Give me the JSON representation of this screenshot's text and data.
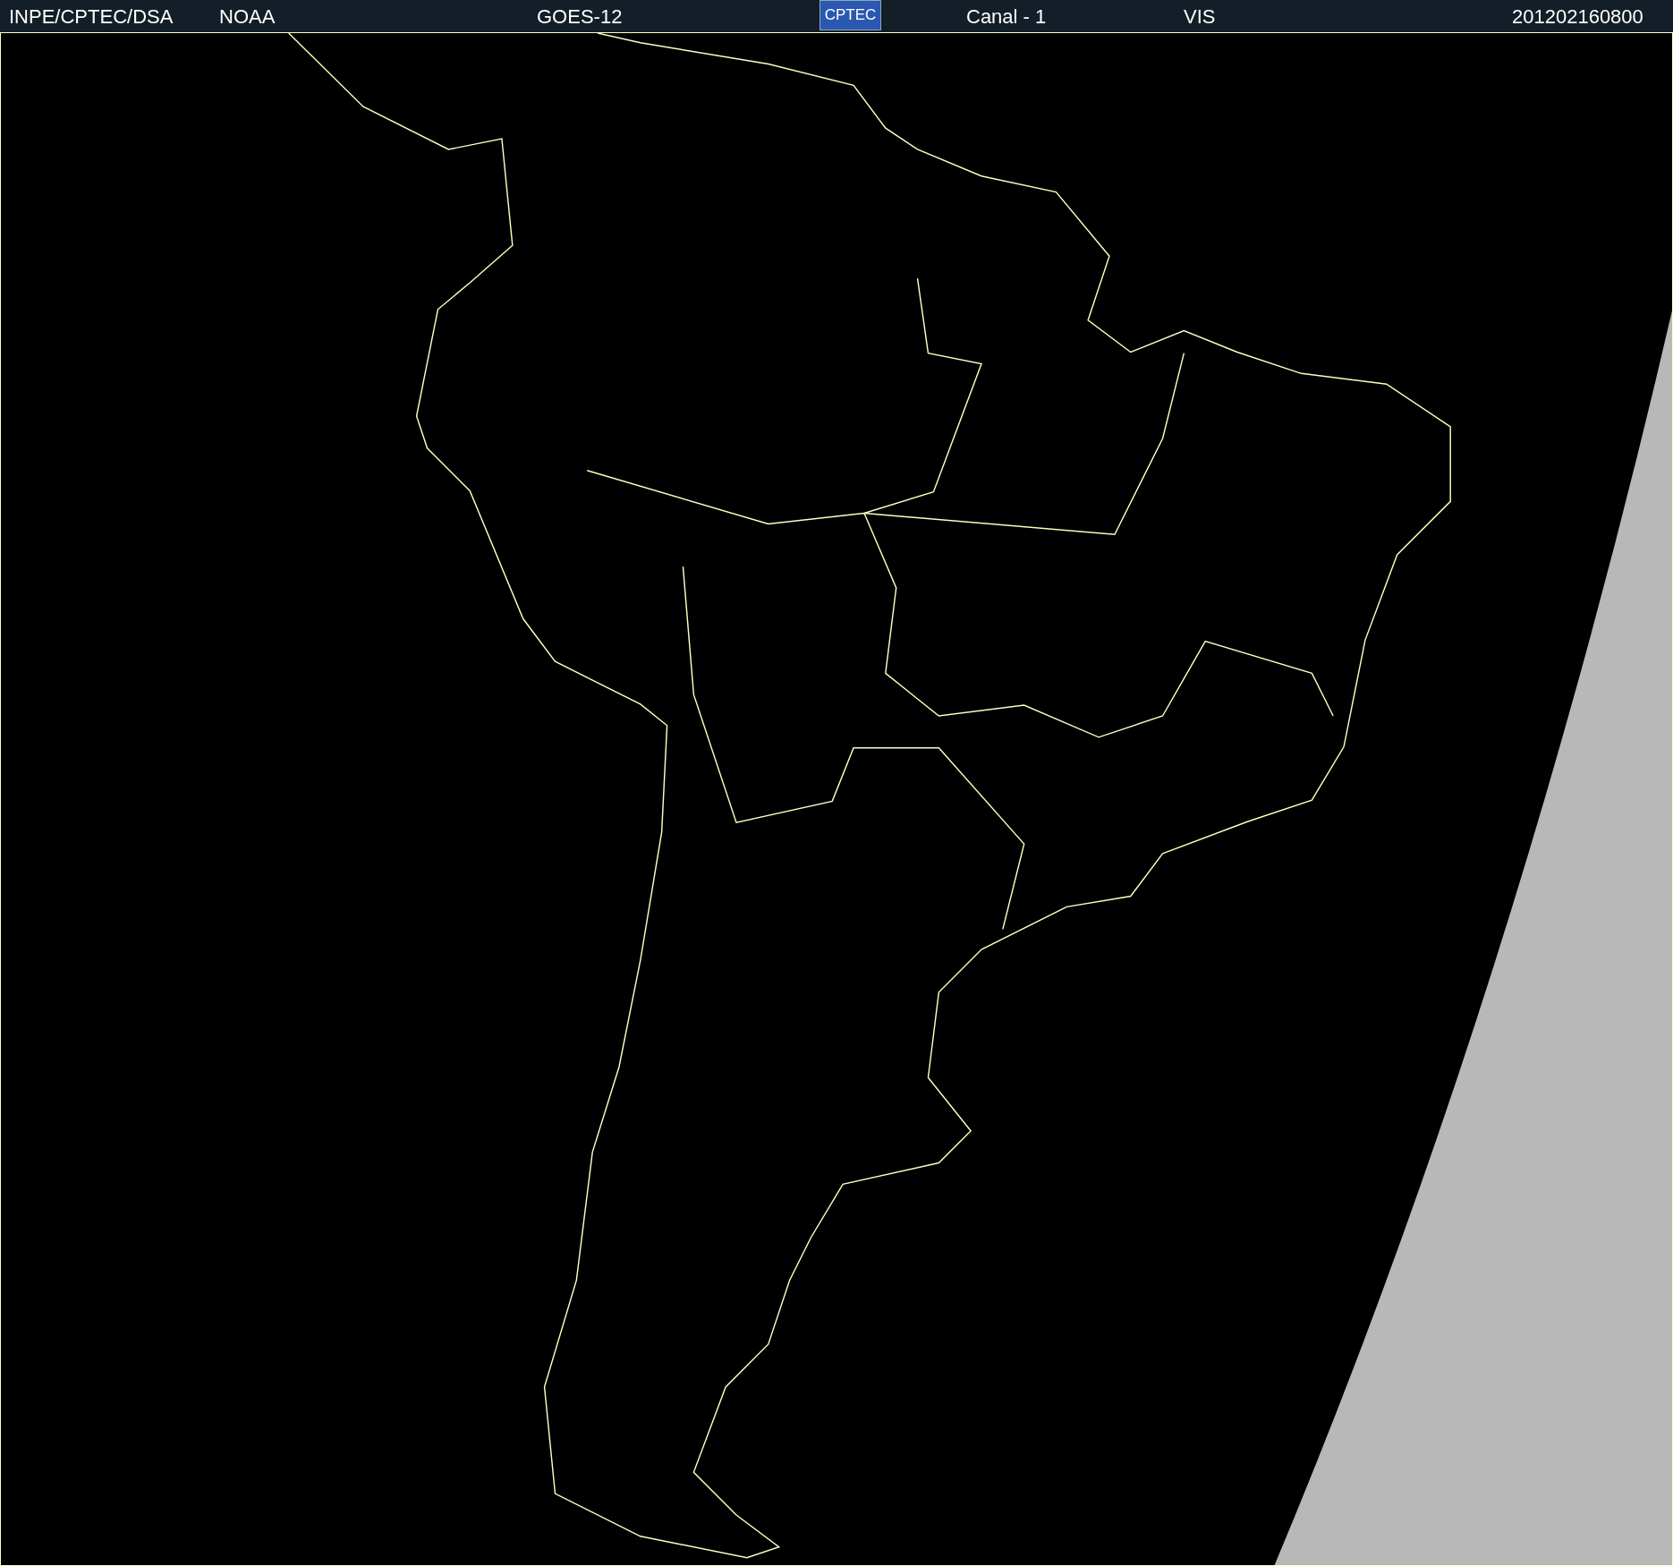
{
  "header": {
    "items": [
      {
        "kind": "text",
        "text": "INPE/CPTEC/DSA"
      },
      {
        "kind": "text",
        "text": "NOAA"
      },
      {
        "kind": "text",
        "text": "GOES-12"
      },
      {
        "kind": "logo",
        "text": "CPTEC"
      },
      {
        "kind": "text",
        "text": "Canal - 1"
      },
      {
        "kind": "text",
        "text": "VIS"
      },
      {
        "kind": "text",
        "text": "201202160800"
      }
    ]
  }
}
